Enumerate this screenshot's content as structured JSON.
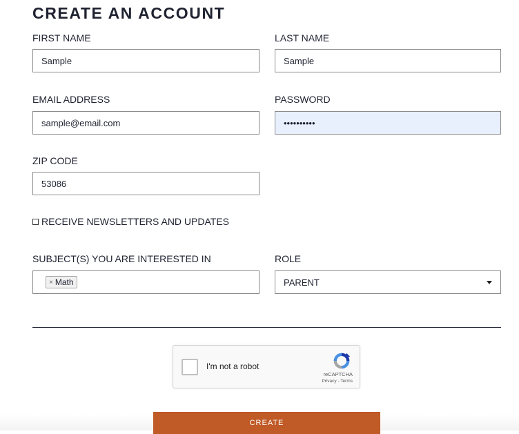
{
  "form": {
    "title": "CREATE AN ACCOUNT",
    "first_name": {
      "label": "FIRST NAME",
      "value": "Sample"
    },
    "last_name": {
      "label": "LAST NAME",
      "value": "Sample"
    },
    "email": {
      "label": "EMAIL ADDRESS",
      "value": "sample@email.com"
    },
    "password": {
      "label": "PASSWORD",
      "value": "••••••••••"
    },
    "zip": {
      "label": "ZIP CODE",
      "value": "53086"
    },
    "newsletter": {
      "label": "RECEIVE NEWSLETTERS AND UPDATES",
      "checked": false
    },
    "subjects": {
      "label": "SUBJECT(S) YOU ARE INTERESTED IN",
      "tags": [
        {
          "remove": "×",
          "text": "Math"
        }
      ]
    },
    "role": {
      "label": "ROLE",
      "value": "PARENT"
    },
    "create_label": "CREATE"
  },
  "recaptcha": {
    "text": "I'm not a robot",
    "brand": "reCAPTCHA",
    "links": "Privacy - Terms"
  },
  "colors": {
    "button": "#c05a26",
    "autofill": "#e8effd",
    "text": "#1f2230"
  },
  "icons": {
    "recaptcha_logo": "recaptcha-logo-icon",
    "dropdown": "chevron-down-icon",
    "tag_remove": "close-icon"
  }
}
